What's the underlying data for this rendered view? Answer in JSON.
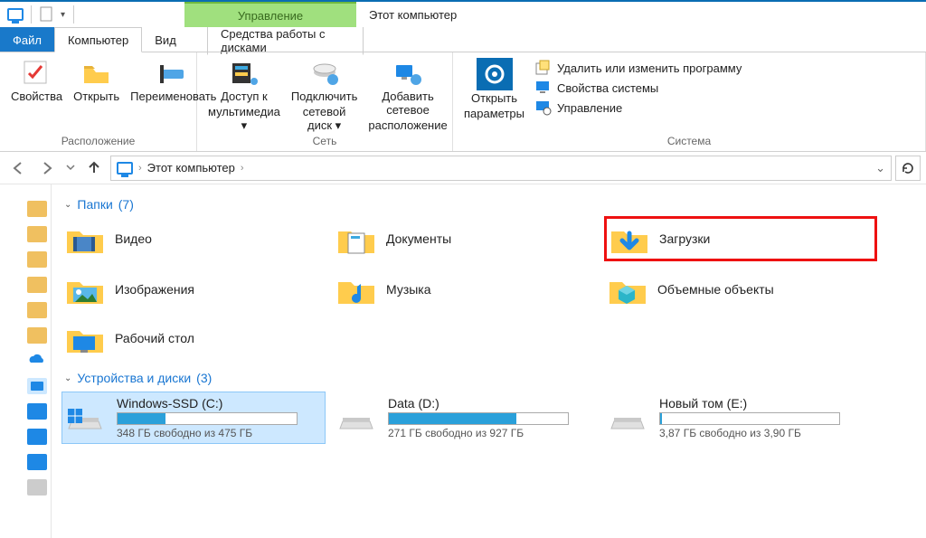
{
  "title": "Этот компьютер",
  "context_tab": "Управление",
  "tabs": {
    "file": "Файл",
    "computer": "Компьютер",
    "view": "Вид",
    "drives": "Средства работы с дисками"
  },
  "ribbon": {
    "location": {
      "label": "Расположение",
      "props": "Свойства",
      "open": "Открыть",
      "rename": "Переименовать"
    },
    "network": {
      "label": "Сеть",
      "media_l1": "Доступ к",
      "media_l2": "мультимедиа",
      "map_l1": "Подключить",
      "map_l2": "сетевой диск",
      "addloc_l1": "Добавить сетевое",
      "addloc_l2": "расположение"
    },
    "system": {
      "label": "Система",
      "settings_l1": "Открыть",
      "settings_l2": "параметры",
      "progs": "Удалить или изменить программу",
      "sysprops": "Свойства системы",
      "manage": "Управление"
    }
  },
  "breadcrumb": {
    "root": "Этот компьютер"
  },
  "groups": {
    "folders": {
      "label": "Папки",
      "count": "(7)",
      "items": [
        {
          "name": "Видео"
        },
        {
          "name": "Документы"
        },
        {
          "name": "Загрузки"
        },
        {
          "name": "Изображения"
        },
        {
          "name": "Музыка"
        },
        {
          "name": "Объемные объекты"
        },
        {
          "name": "Рабочий стол"
        }
      ]
    },
    "drives": {
      "label": "Устройства и диски",
      "count": "(3)",
      "items": [
        {
          "name": "Windows-SSD (C:)",
          "free": "348 ГБ свободно из 475 ГБ",
          "pct": 27
        },
        {
          "name": "Data (D:)",
          "free": "271 ГБ свободно из 927 ГБ",
          "pct": 71
        },
        {
          "name": "Новый том (E:)",
          "free": "3,87 ГБ свободно из 3,90 ГБ",
          "pct": 1
        }
      ]
    }
  }
}
